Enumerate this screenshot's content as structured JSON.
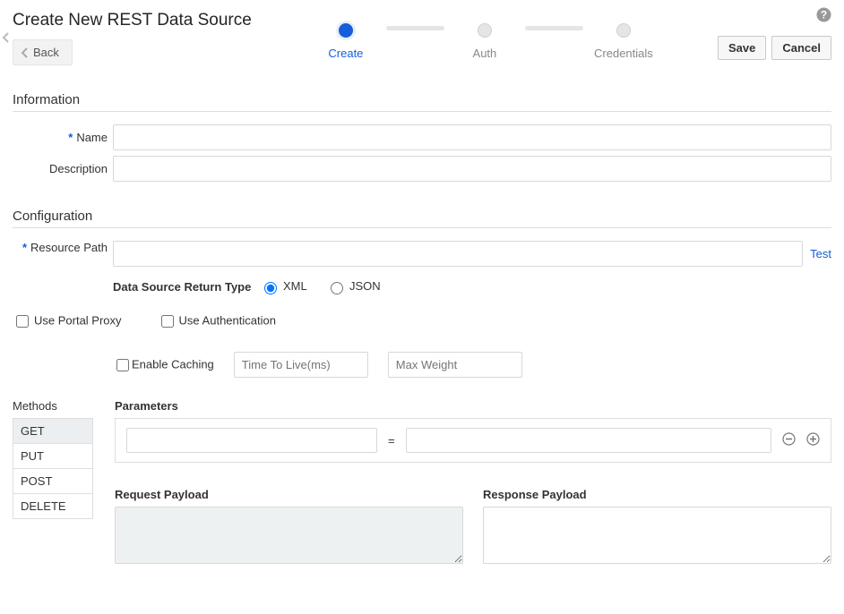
{
  "header": {
    "title": "Create New REST Data Source",
    "back_label": "Back",
    "save_label": "Save",
    "cancel_label": "Cancel"
  },
  "wizard": {
    "steps": [
      {
        "label": "Create",
        "active": true
      },
      {
        "label": "Auth",
        "active": false
      },
      {
        "label": "Credentials",
        "active": false
      }
    ]
  },
  "sections": {
    "information": {
      "title": "Information",
      "name_label": "Name",
      "name_value": "",
      "desc_label": "Description",
      "desc_value": ""
    },
    "configuration": {
      "title": "Configuration",
      "resource_label": "Resource Path",
      "resource_value": "",
      "test_label": "Test",
      "return_type_label": "Data Source Return Type",
      "return_options": {
        "xml": "XML",
        "json": "JSON"
      },
      "use_proxy_label": "Use Portal Proxy",
      "use_auth_label": "Use Authentication",
      "enable_caching_label": "Enable Caching",
      "ttl_placeholder": "Time To Live(ms)",
      "maxweight_placeholder": "Max Weight"
    },
    "methods": {
      "title": "Methods",
      "items": [
        "GET",
        "PUT",
        "POST",
        "DELETE"
      ],
      "selected": "GET"
    },
    "parameters": {
      "title": "Parameters",
      "equals": "="
    },
    "payloads": {
      "request_title": "Request Payload",
      "response_title": "Response Payload"
    }
  }
}
